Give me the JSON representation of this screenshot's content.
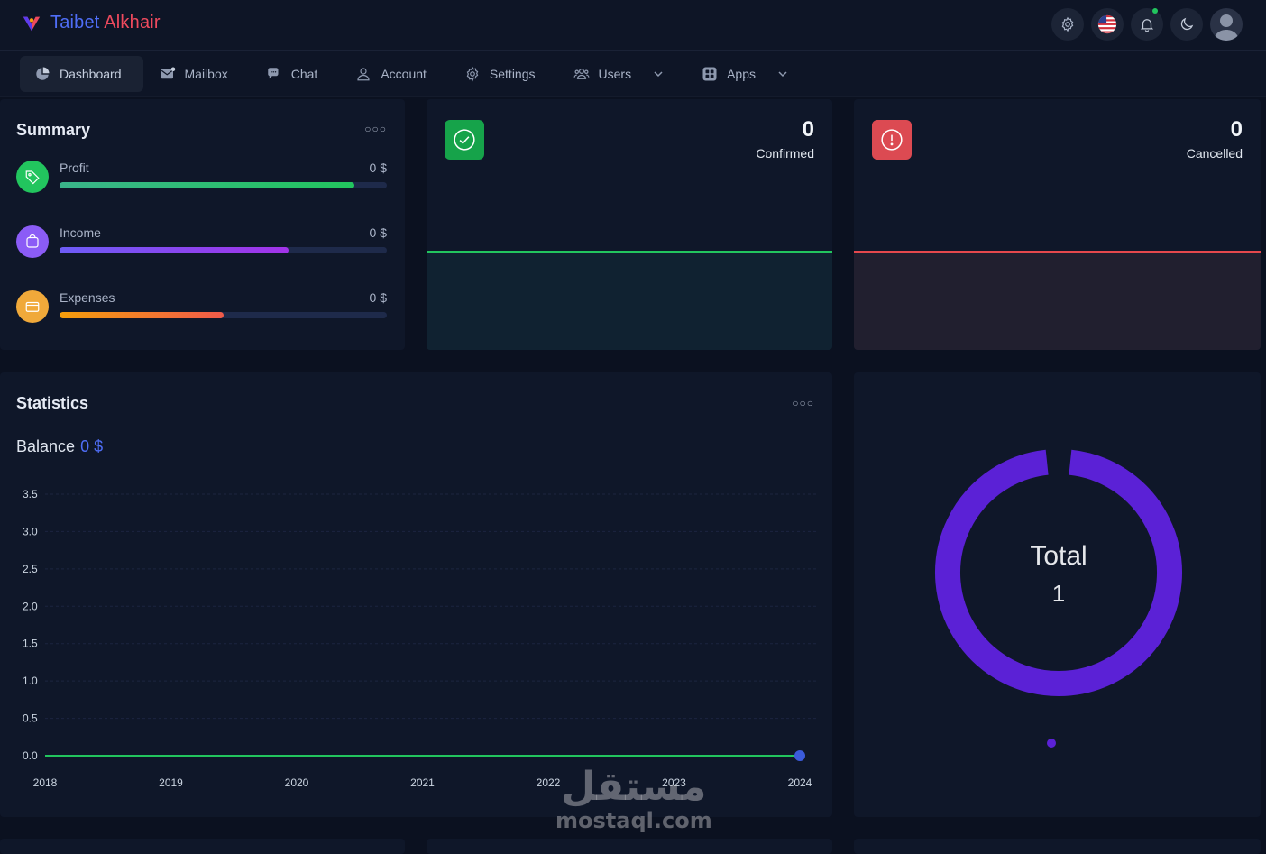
{
  "brand": {
    "part1": "Taibet",
    "part2": "Alkhair"
  },
  "header_icons": [
    "gear-icon",
    "us-flag-icon",
    "bell-icon",
    "moon-icon",
    "avatar"
  ],
  "nav": [
    {
      "label": "Dashboard",
      "icon": "dashboard-icon",
      "active": true
    },
    {
      "label": "Mailbox",
      "icon": "mail-icon"
    },
    {
      "label": "Chat",
      "icon": "chat-icon"
    },
    {
      "label": "Account",
      "icon": "user-icon"
    },
    {
      "label": "Settings",
      "icon": "gear-icon"
    },
    {
      "label": "Users",
      "icon": "users-icon",
      "dropdown": true
    },
    {
      "label": "Apps",
      "icon": "apps-icon",
      "dropdown": true
    }
  ],
  "summary": {
    "title": "Summary",
    "items": [
      {
        "label": "Profit",
        "value": "0 $",
        "fill": 0.9,
        "icon": "tag-icon",
        "color": "#22c55e"
      },
      {
        "label": "Income",
        "value": "0 $",
        "fill": 0.7,
        "icon": "bag-icon",
        "color": "#8b5cf6"
      },
      {
        "label": "Expenses",
        "value": "0 $",
        "fill": 0.5,
        "icon": "card-icon",
        "color": "#f59e0b"
      }
    ]
  },
  "confirmed": {
    "value": "0",
    "label": "Confirmed",
    "color": "#16a34a"
  },
  "cancelled": {
    "value": "0",
    "label": "Cancelled",
    "color": "#dc4a52"
  },
  "statistics": {
    "title": "Statistics",
    "balance_label": "Balance",
    "balance_value": "0 $"
  },
  "donut": {
    "title": "Total",
    "value": "1",
    "color": "#5b21d6"
  },
  "watermark": {
    "ar": "مستقل",
    "en": "mostaql.com"
  },
  "chart_data": {
    "type": "line",
    "x": [
      "2018",
      "2019",
      "2020",
      "2021",
      "2022",
      "2023",
      "2024"
    ],
    "series": [
      {
        "values": [
          0,
          0,
          0,
          0,
          0,
          0,
          0
        ]
      }
    ],
    "yticks": [
      "0.0",
      "0.5",
      "1.0",
      "1.5",
      "2.0",
      "2.5",
      "3.0",
      "3.5"
    ],
    "ylim": [
      0,
      3.5
    ],
    "grid": true,
    "line_color": "#22c55e",
    "marker_color": "#3b5bdb"
  }
}
